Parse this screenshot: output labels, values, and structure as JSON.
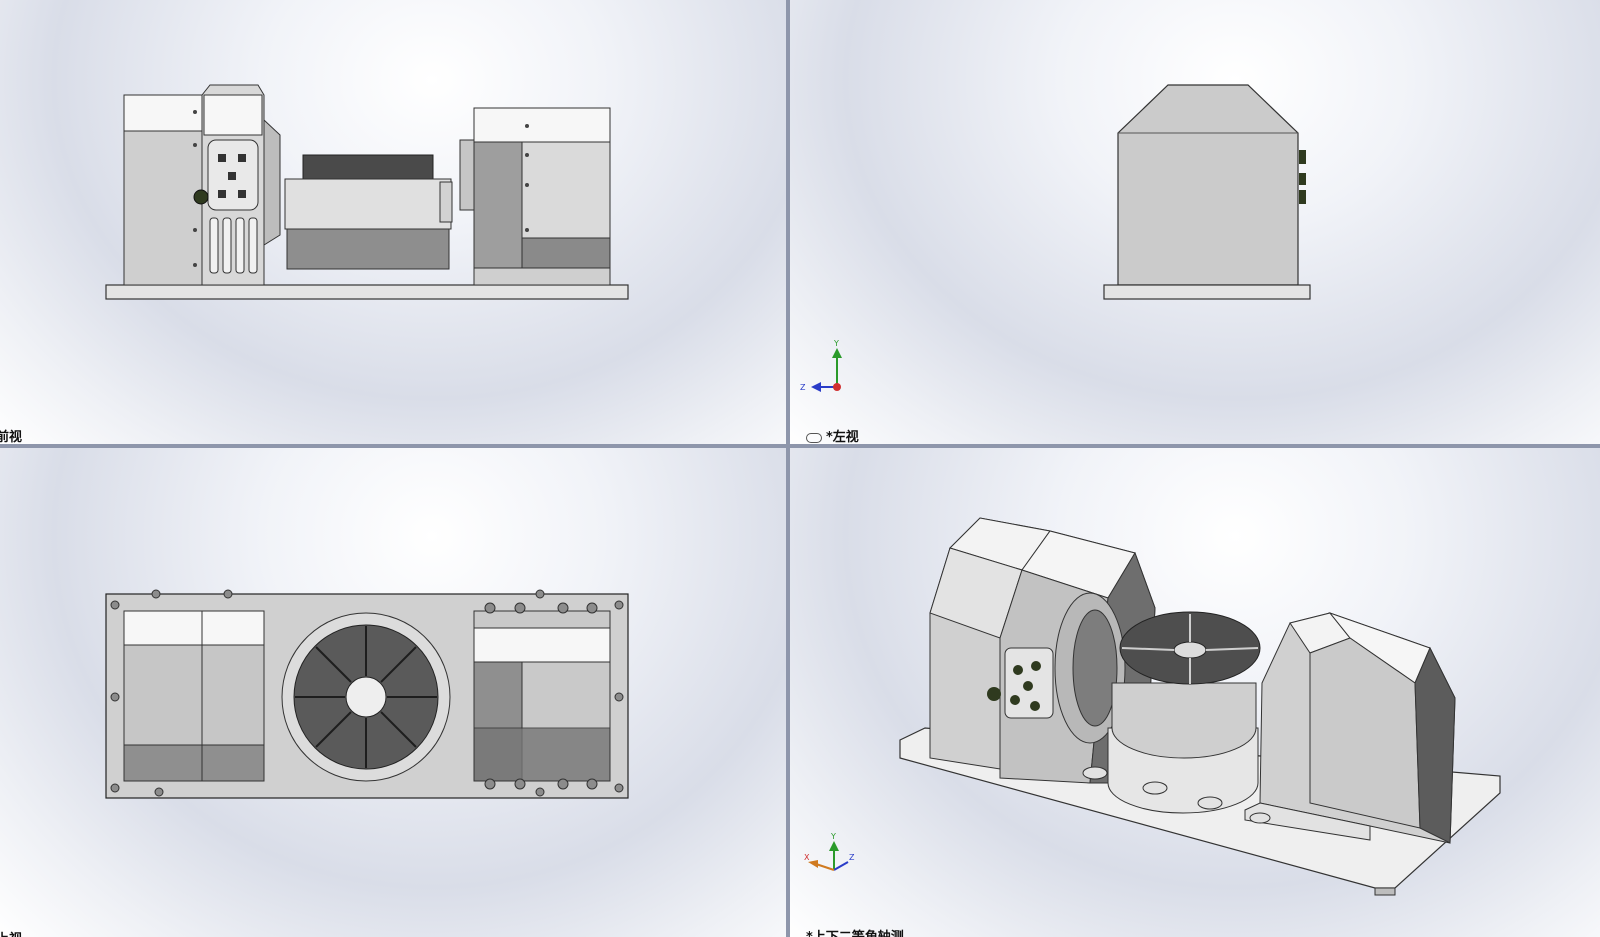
{
  "viewports": {
    "front": {
      "label": "前视"
    },
    "left": {
      "label": "*左视"
    },
    "top": {
      "label": "上视"
    },
    "iso": {
      "label": "*上下二等角轴测"
    }
  },
  "triad": {
    "x": "X",
    "y": "Y",
    "z": "Z"
  },
  "colors": {
    "background_center": "#ffffff",
    "background_edge": "#d9dde8",
    "divider": "#8e96ab",
    "part_light": "#e6e6e6",
    "part_mid": "#c4c4c4",
    "part_dark": "#6f6f6f",
    "axis_x": "#d03030",
    "axis_y": "#2a9a2a",
    "axis_z": "#2a3cc8"
  }
}
